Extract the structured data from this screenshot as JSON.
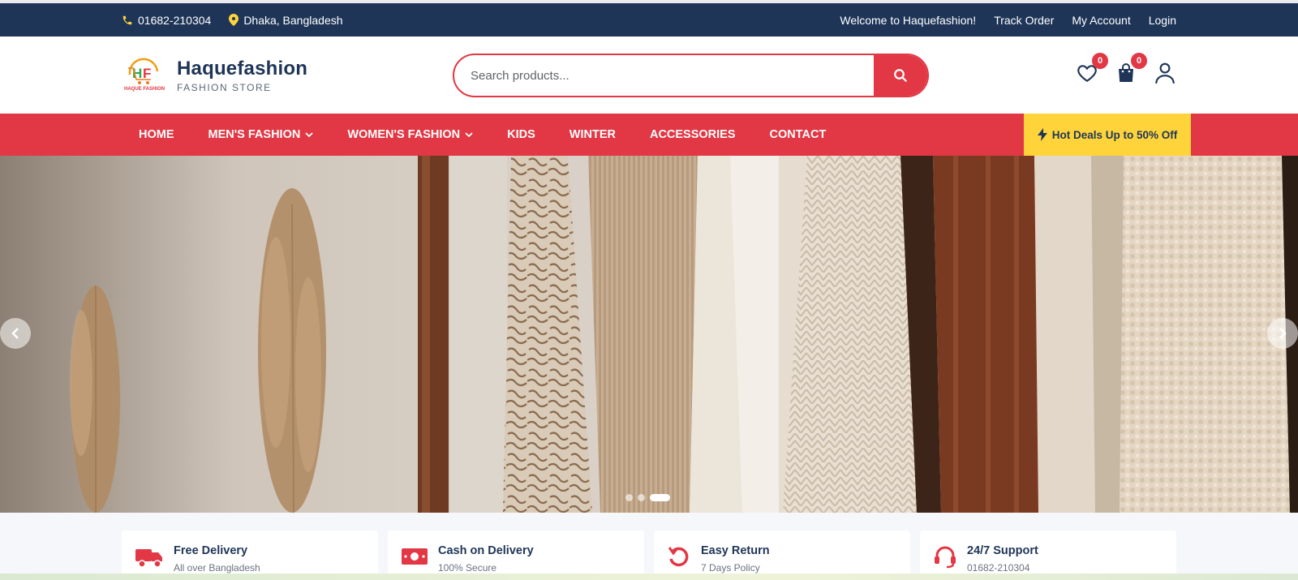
{
  "topbar": {
    "phone": "01682-210304",
    "location": "Dhaka, Bangladesh",
    "welcome": "Welcome to Haquefashion!",
    "track_order": "Track Order",
    "my_account": "My Account",
    "login": "Login"
  },
  "brand": {
    "name": "Haquefashion",
    "tagline": "FASHION STORE",
    "logo_text": "HAQUE FASHION"
  },
  "search": {
    "placeholder": "Search products..."
  },
  "header_icons": {
    "wishlist_count": "0",
    "cart_count": "0"
  },
  "nav": {
    "items": [
      {
        "label": "HOME"
      },
      {
        "label": "MEN'S FASHION"
      },
      {
        "label": "WOMEN'S FASHION"
      },
      {
        "label": "KIDS"
      },
      {
        "label": "WINTER"
      },
      {
        "label": "ACCESSORIES"
      },
      {
        "label": "CONTACT"
      }
    ],
    "deals_label": "Hot Deals Up to 50% Off"
  },
  "slider": {
    "dots": 3,
    "active_index": 2
  },
  "features": [
    {
      "title": "Free Delivery",
      "desc": "All over Bangladesh",
      "icon": "truck-icon"
    },
    {
      "title": "Cash on Delivery",
      "desc": "100% Secure",
      "icon": "cash-icon"
    },
    {
      "title": "Easy Return",
      "desc": "7 Days Policy",
      "icon": "return-icon"
    },
    {
      "title": "24/7 Support",
      "desc": "01682-210304",
      "icon": "headset-icon"
    }
  ],
  "colors": {
    "navy": "#1e3558",
    "accent_red": "#e23744",
    "deal_yellow": "#ffd43b"
  }
}
